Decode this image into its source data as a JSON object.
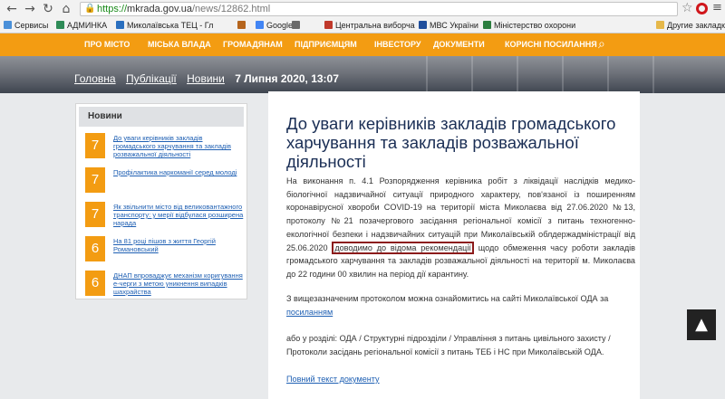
{
  "browser": {
    "url_scheme": "https://",
    "url_host": "mkrada.gov.ua",
    "url_path": "/news/12862.html",
    "bookmarks": [
      {
        "label": "Сервисы",
        "icon": "apps-icon",
        "color": "#4a90d9"
      },
      {
        "label": "АДМИНКА",
        "icon": "bookmark-icon",
        "color": "#2e8b57"
      },
      {
        "label": "Миколаївська ТЕЦ - Гл",
        "icon": "bookmark-icon",
        "color": "#2a6fbf"
      },
      {
        "label": "",
        "icon": "bookmark-icon",
        "color": "#b5651d"
      },
      {
        "label": "Google",
        "icon": "google-icon",
        "color": "#4285f4"
      },
      {
        "label": "",
        "icon": "bookmark-icon",
        "color": "#6a6a6a"
      },
      {
        "label": "Центральна виборча",
        "icon": "bookmark-icon",
        "color": "#c0392b"
      },
      {
        "label": "МВС України",
        "icon": "bookmark-icon",
        "color": "#1f4e9c"
      },
      {
        "label": "Міністерство охорони",
        "icon": "bookmark-icon",
        "color": "#2a7d3e"
      },
      {
        "label": "Другие закладки",
        "icon": "folder-icon",
        "color": "#e6b84a"
      }
    ]
  },
  "topnav": {
    "items": [
      "ПРО МІСТО",
      "МІСЬКА ВЛАДА",
      "ГРОМАДЯНАМ",
      "ПІДПРИЄМЦЯМ",
      "ІНВЕСТОРУ",
      "ДОКУМЕНТИ",
      "КОРИСНІ ПОСИЛАННЯ"
    ]
  },
  "breadcrumb": {
    "home": "Головна",
    "pubs": "Публікації",
    "news": "Новини",
    "date": "7 Липня 2020, 13:07"
  },
  "sidebar": {
    "title": "Новини",
    "items": [
      {
        "badge": "7",
        "text": "До уваги керівників закладів громадського харчування та закладів розважальної діяльності"
      },
      {
        "badge": "7",
        "text": "Профілактика наркоманії серед молоді"
      },
      {
        "badge": "7",
        "text": "Як звільнити місто від великовантажного транспорту: у мерії відбулася розширена нарада"
      },
      {
        "badge": "6",
        "text": "На 81 році пішов з життя Георгій Романовський"
      },
      {
        "badge": "6",
        "text": "ДНАП впроваджує механізм коригування е-черги з метою уникнення випадків шахрайства"
      }
    ]
  },
  "article": {
    "title": "До уваги керівників закладів громадського харчування та закладів розважальної діяльності",
    "p1_before": "На виконання п. 4.1 Розпорядження керівника робіт з ліквідації наслідків медико-біологічної надзвичайної ситуації природного характеру, пов'язаної із поширенням коронавірусної хвороби COVID-19 на території міста Миколаєва від 27.06.2020 №13, протоколу №21 позачергового засідання регіональної комісії з питань техногенно-екологічної безпеки і надзвичайних ситуацій при Миколаївській облдержадміністрації від 25.06.2020",
    "p1_highlight": "доводимо до відома рекомендації",
    "p1_after": "щодо обмеження часу роботи закладів громадського харчування та закладів розважальної діяльності на території м. Миколаєва до 22 години 00 хвилин на період дії карантину.",
    "p2_text": "З вищезазначеним протоколом можна ознайомитись на сайті Миколаївської ОДА за",
    "p2_link": "посиланням",
    "p3": "або у розділі: ОДА / Структурні підрозділи / Управління з питань цивільного захисту / Протоколи засідань регіональної комісії з питань ТЕБ і НС при Миколаївській ОДА.",
    "full_link": "Повний текст документу"
  },
  "colors": {
    "accent": "#f39c12",
    "title": "#1a2e55",
    "link": "#1e5fb3",
    "highlight_border": "#8c1b1b"
  }
}
